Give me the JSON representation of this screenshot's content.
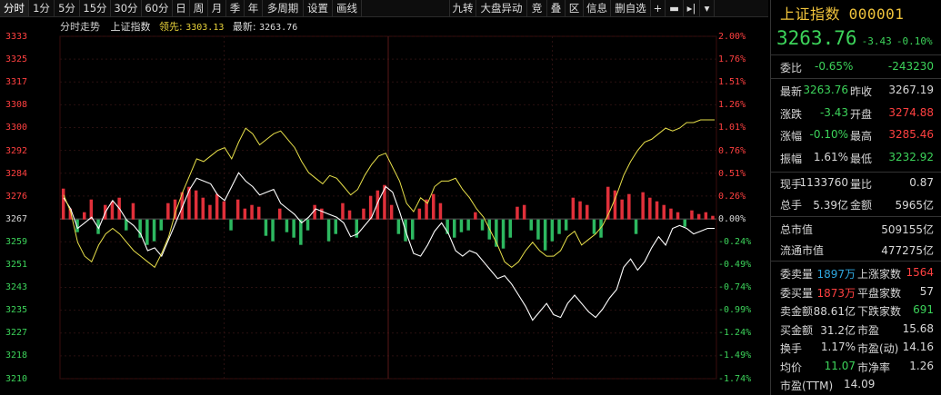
{
  "toolbar": {
    "tabs": [
      "分时",
      "1分",
      "5分",
      "15分",
      "30分",
      "60分",
      "日",
      "周",
      "月",
      "季",
      "年",
      "多周期",
      "设置",
      "画线"
    ],
    "active": "分时",
    "right": [
      "九转",
      "大盘异动",
      "竞",
      "叠",
      "区",
      "信息",
      "删自选"
    ],
    "icons": [
      "+",
      "▬",
      "▸|",
      "▾"
    ]
  },
  "chart_head": {
    "mode": "分时走势",
    "name": "上证指数",
    "lead_label": "领先:",
    "lead_value": "3303.13",
    "last_label": "最新:",
    "last_value": "3263.76"
  },
  "chart_data": {
    "type": "line",
    "title": "",
    "prev_close": 3267.19,
    "ylim": [
      3210,
      3333
    ],
    "y_ticks": [
      "3333",
      "3325",
      "3317",
      "3308",
      "3300",
      "3292",
      "3284",
      "3276",
      "3267",
      "3259",
      "3251",
      "3243",
      "3235",
      "3227",
      "3218",
      "3210"
    ],
    "pct_ticks": [
      "2.00%",
      "1.76%",
      "1.51%",
      "1.26%",
      "1.01%",
      "0.76%",
      "0.51%",
      "0.26%",
      "0.00%",
      "-0.24%",
      "-0.49%",
      "-0.74%",
      "-0.99%",
      "-1.24%",
      "-1.49%",
      "-1.74%"
    ],
    "series": [
      {
        "values": [
          3275,
          3271,
          3264,
          3266,
          3268,
          3264,
          3270,
          3274,
          3271,
          3267,
          3265,
          3262,
          3256,
          3257,
          3254,
          3260,
          3266,
          3272,
          3278,
          3282,
          3281,
          3280,
          3276,
          3274,
          3279,
          3284,
          3281,
          3279,
          3276,
          3277,
          3278,
          3273,
          3271,
          3269,
          3266,
          3268,
          3271,
          3270,
          3269,
          3268,
          3266,
          3261,
          3262,
          3265,
          3268,
          3274,
          3279,
          3277,
          3270,
          3262,
          3255,
          3254,
          3258,
          3263,
          3266,
          3262,
          3256,
          3254,
          3256,
          3255,
          3252,
          3249,
          3246,
          3247,
          3244,
          3240,
          3236,
          3231,
          3234,
          3237,
          3233,
          3232,
          3237,
          3240,
          3237,
          3234,
          3232,
          3235,
          3239,
          3242,
          3250,
          3253,
          3249,
          3252,
          3257,
          3261,
          3258,
          3264,
          3265,
          3264,
          3262,
          3263,
          3264,
          3264
        ]
      },
      {
        "values": [
          3276,
          3270,
          3259,
          3254,
          3252,
          3258,
          3262,
          3264,
          3262,
          3259,
          3256,
          3254,
          3252,
          3250,
          3255,
          3261,
          3270,
          3277,
          3283,
          3289,
          3288,
          3290,
          3292,
          3293,
          3289,
          3295,
          3300,
          3298,
          3294,
          3296,
          3298,
          3299,
          3296,
          3293,
          3288,
          3284,
          3282,
          3280,
          3283,
          3282,
          3279,
          3276,
          3278,
          3283,
          3287,
          3290,
          3291,
          3286,
          3281,
          3273,
          3270,
          3275,
          3273,
          3279,
          3281,
          3281,
          3282,
          3278,
          3275,
          3271,
          3268,
          3263,
          3258,
          3252,
          3250,
          3252,
          3256,
          3259,
          3256,
          3254,
          3254,
          3256,
          3261,
          3263,
          3258,
          3260,
          3262,
          3265,
          3270,
          3276,
          3283,
          3288,
          3292,
          3295,
          3296,
          3298,
          3300,
          3299,
          3300,
          3302,
          3302,
          3303,
          3303,
          3303
        ]
      }
    ],
    "volume": [
      0.85,
      0.3,
      -0.35,
      0.2,
      0.55,
      -0.4,
      0.4,
      0.5,
      0.6,
      -0.3,
      0.45,
      -0.5,
      -0.7,
      -0.6,
      -0.3,
      0.45,
      0.55,
      0.75,
      0.9,
      0.8,
      0.6,
      0.4,
      0.7,
      0.5,
      -0.3,
      0.55,
      0.3,
      0.4,
      0.35,
      -0.45,
      -0.6,
      0.3,
      -0.35,
      -0.5,
      -0.7,
      -0.3,
      0.4,
      0.3,
      -0.6,
      -0.4,
      0.45,
      0.25,
      -0.5,
      0.3,
      0.65,
      0.8,
      0.95,
      0.4,
      -0.4,
      -0.6,
      -0.55,
      0.3,
      0.55,
      0.7,
      0.45,
      -0.4,
      -0.5,
      -0.35,
      -0.3,
      0.2,
      -0.3,
      -0.55,
      -0.75,
      -0.8,
      -0.5,
      0.35,
      0.4,
      -0.3,
      -0.55,
      -0.85,
      -0.6,
      -0.4,
      -0.3,
      0.6,
      0.5,
      0.4,
      -0.4,
      -0.5,
      0.9,
      0.8,
      0.55,
      0.7,
      -0.4,
      0.75,
      0.6,
      0.5,
      0.4,
      0.3,
      0.2,
      -0.2,
      0.25,
      0.15,
      0.2,
      0.1
    ]
  },
  "panel": {
    "name": "上证指数",
    "code": "000001",
    "price": "3263.76",
    "change": "-3.43",
    "change_pct": "-0.10%",
    "wb_label": "委比",
    "wb_pct": "-0.65%",
    "wb_val": "-243230",
    "rows": [
      {
        "l1": "最新",
        "v1": "3263.76",
        "c1": "g",
        "l2": "昨收",
        "v2": "3267.19",
        "c2": "w"
      },
      {
        "l1": "涨跌",
        "v1": "-3.43",
        "c1": "g",
        "l2": "开盘",
        "v2": "3274.88",
        "c2": "r"
      },
      {
        "l1": "涨幅",
        "v1": "-0.10%",
        "c1": "g",
        "l2": "最高",
        "v2": "3285.46",
        "c2": "r"
      },
      {
        "l1": "振幅",
        "v1": "1.61%",
        "c1": "w",
        "l2": "最低",
        "v2": "3232.92",
        "c2": "g"
      }
    ],
    "vol_rows": [
      {
        "l1": "现手",
        "v1": "1133760",
        "c1": "w",
        "l2": "量比",
        "v2": "0.87",
        "c2": "w"
      },
      {
        "l1": "总手",
        "v1": "5.39亿",
        "c1": "w",
        "l2": "金额",
        "v2": "5965亿",
        "c2": "w"
      }
    ],
    "cap_rows": [
      {
        "l": "总市值",
        "v": "509155亿"
      },
      {
        "l": "流通市值",
        "v": "477275亿"
      }
    ],
    "breadth": [
      {
        "l1": "委卖量",
        "v1": "1897万",
        "c1": "b",
        "l2": "上涨家数",
        "v2": "1564",
        "c2": "r"
      },
      {
        "l1": "委买量",
        "v1": "1873万",
        "c1": "r",
        "l2": "平盘家数",
        "v2": "57",
        "c2": "w"
      },
      {
        "l1": "卖金额",
        "v1": "88.61亿",
        "c1": "w",
        "l2": "下跌家数",
        "v2": "691",
        "c2": "g"
      },
      {
        "l1": "买金额",
        "v1": "31.2亿",
        "c1": "w",
        "l2": "市盈",
        "v2": "15.68",
        "c2": "w"
      },
      {
        "l1": "换手",
        "v1": "1.17%",
        "c1": "w",
        "l2": "市盈(动)",
        "v2": "14.16",
        "c2": "w"
      },
      {
        "l1": "均价",
        "v1": "11.07",
        "c1": "g",
        "l2": "市净率",
        "v2": "1.26",
        "c2": "w"
      }
    ],
    "pe_ttm_label": "市盈(TTM)",
    "pe_ttm": "14.09"
  }
}
